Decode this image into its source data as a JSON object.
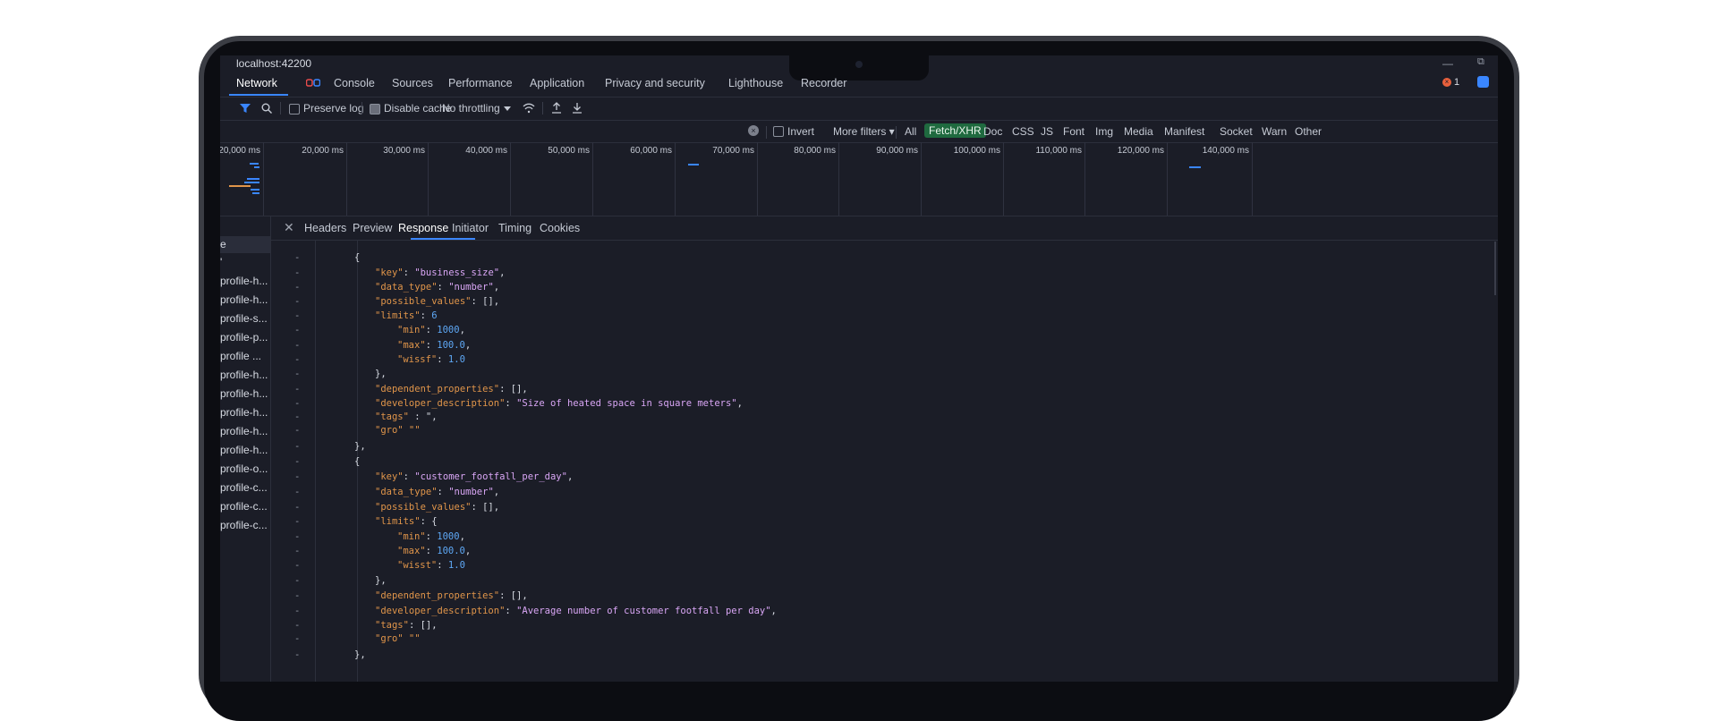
{
  "window": {
    "url": "localhost:42200",
    "minimize": "—",
    "maximize": "⧉"
  },
  "tabs": [
    {
      "label": "Network"
    },
    {
      "label": "Console"
    },
    {
      "label": "Sources"
    },
    {
      "label": "Performance"
    },
    {
      "label": "Application"
    },
    {
      "label": "Privacy and security"
    },
    {
      "label": "Lighthouse"
    },
    {
      "label": "Recorder"
    }
  ],
  "issues": {
    "count": "1"
  },
  "toolbar": {
    "preserve_log": "Preserve log",
    "disable_cache": "Disable cache",
    "throttling": "No throttling"
  },
  "filters": {
    "invert": "Invert",
    "more": "More filters ▾",
    "types": [
      "All",
      "Fetch/XHR",
      "Doc",
      "CSS",
      "JS",
      "Font",
      "Img",
      "Media",
      "Manifest",
      "Socket",
      "Warn",
      "Other"
    ],
    "active": "Fetch/XHR"
  },
  "timeline": {
    "ticks": [
      "20,000 ms",
      "20,000 ms",
      "30,000 ms",
      "40,000 ms",
      "50,000 ms",
      "60,000 ms",
      "70,000 ms",
      "80,000 ms",
      "90,000 ms",
      "100,000 ms",
      "110,000 ms",
      "120,000 ms",
      "140,000 ms"
    ]
  },
  "requests": {
    "top_labels": [
      "e",
      "'"
    ],
    "rows": [
      "profile-h...",
      "profile-h...",
      "profile-s...",
      "profile-p...",
      "profile ...",
      "profile-h...",
      "profile-h...",
      "profile-h...",
      "profile-h...",
      "profile-h...",
      "profile-o...",
      "profile-c...",
      "profile-c...",
      "profile-c..."
    ]
  },
  "detail_tabs": [
    "Headers",
    "Preview",
    "Response",
    "Initiator",
    "Timing",
    "Cookies"
  ],
  "detail_active": "Response",
  "response": {
    "gutter_mark": "-",
    "lines": [
      {
        "p1": "{"
      },
      {
        "k": "\"key\"",
        "p1": ": ",
        "s": "\"business_size\"",
        "p2": ","
      },
      {
        "k": "\"data_type\"",
        "p1": ": ",
        "s": "\"number\"",
        "p2": ","
      },
      {
        "k": "\"possible_values\"",
        "p1": ": [],"
      },
      {
        "k": "\"limits\"",
        "p1": ": ",
        "n": "6"
      },
      {
        "k": "\"min\"",
        "p1": ": ",
        "n": "1000",
        "p2": ","
      },
      {
        "k": "\"max\"",
        "p1": ": ",
        "n": "100.0",
        "p2": ","
      },
      {
        "k": "\"wissf\"",
        "p1": ": ",
        "n": "1.0"
      },
      {
        "p1": "},"
      },
      {
        "k": "\"dependent_properties\"",
        "p1": ": [],"
      },
      {
        "k": "\"developer_description\"",
        "p1": ": ",
        "s": "\"Size of heated space in square meters\"",
        "p2": ","
      },
      {
        "k": "\"tags\"",
        "p1": " : \","
      },
      {
        "k": "\"gro\" \"\""
      },
      {
        "p1": "},"
      },
      {
        "p1": "{"
      },
      {
        "k": "\"key\"",
        "p1": ": ",
        "s": "\"customer_footfall_per_day\"",
        "p2": ","
      },
      {
        "k": "\"data_type\"",
        "p1": ": ",
        "s": "\"number\"",
        "p2": ","
      },
      {
        "k": "\"possible_values\"",
        "p1": ": [],"
      },
      {
        "k": "\"limits\"",
        "p1": ": {"
      },
      {
        "k": "\"min\"",
        "p1": ": ",
        "n": "1000",
        "p2": ","
      },
      {
        "k": "\"max\"",
        "p1": ": ",
        "n": "100.0",
        "p2": ","
      },
      {
        "k": "\"wisst\"",
        "p1": ": ",
        "n": "1.0"
      },
      {
        "p1": "},"
      },
      {
        "k": "\"dependent_properties\"",
        "p1": ": [],"
      },
      {
        "k": "\"developer_description\"",
        "p1": ": ",
        "s": "\"Average number of customer footfall per day\"",
        "p2": ","
      },
      {
        "k": "\"tags\"",
        "p1": ": [],"
      },
      {
        "k": "\"gro\" \"\""
      },
      {
        "p1": "},"
      }
    ]
  },
  "colors": {
    "accent": "#3a86ff",
    "active_filter": "#1f6a3f",
    "key": "#e0954a",
    "string": "#d9a6f5",
    "number": "#5ea8f5"
  }
}
